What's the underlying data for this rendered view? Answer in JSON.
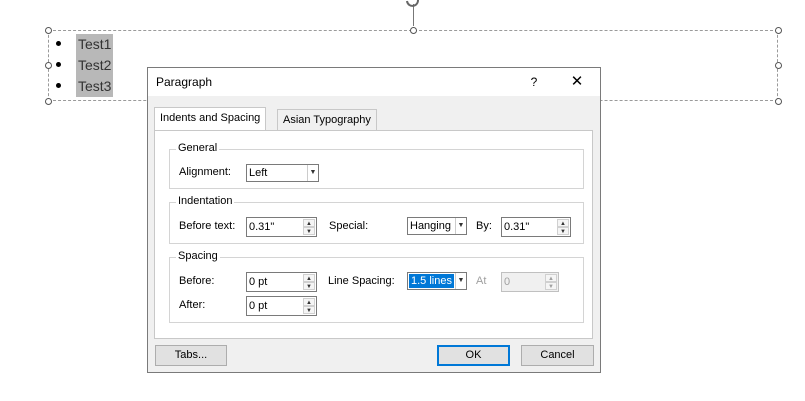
{
  "slide": {
    "bullets": [
      "Test1",
      "Test2",
      "Test3"
    ]
  },
  "dialog": {
    "title": "Paragraph",
    "help_label": "?",
    "close_label": "✕",
    "tabs": [
      "Indents and Spacing",
      "Asian Typography"
    ],
    "general": {
      "title": "General",
      "alignment_label": "Alignment:",
      "alignment_value": "Left"
    },
    "indentation": {
      "title": "Indentation",
      "before_text_label": "Before text:",
      "before_text_value": "0.31\"",
      "special_label": "Special:",
      "special_value": "Hanging",
      "by_label": "By:",
      "by_value": "0.31\""
    },
    "spacing": {
      "title": "Spacing",
      "before_label": "Before:",
      "before_value": "0 pt",
      "after_label": "After:",
      "after_value": "0 pt",
      "line_spacing_label": "Line Spacing:",
      "line_spacing_value": "1.5 lines",
      "at_label": "At",
      "at_value": "0"
    },
    "buttons": {
      "tabs": "Tabs...",
      "ok": "OK",
      "cancel": "Cancel"
    }
  }
}
